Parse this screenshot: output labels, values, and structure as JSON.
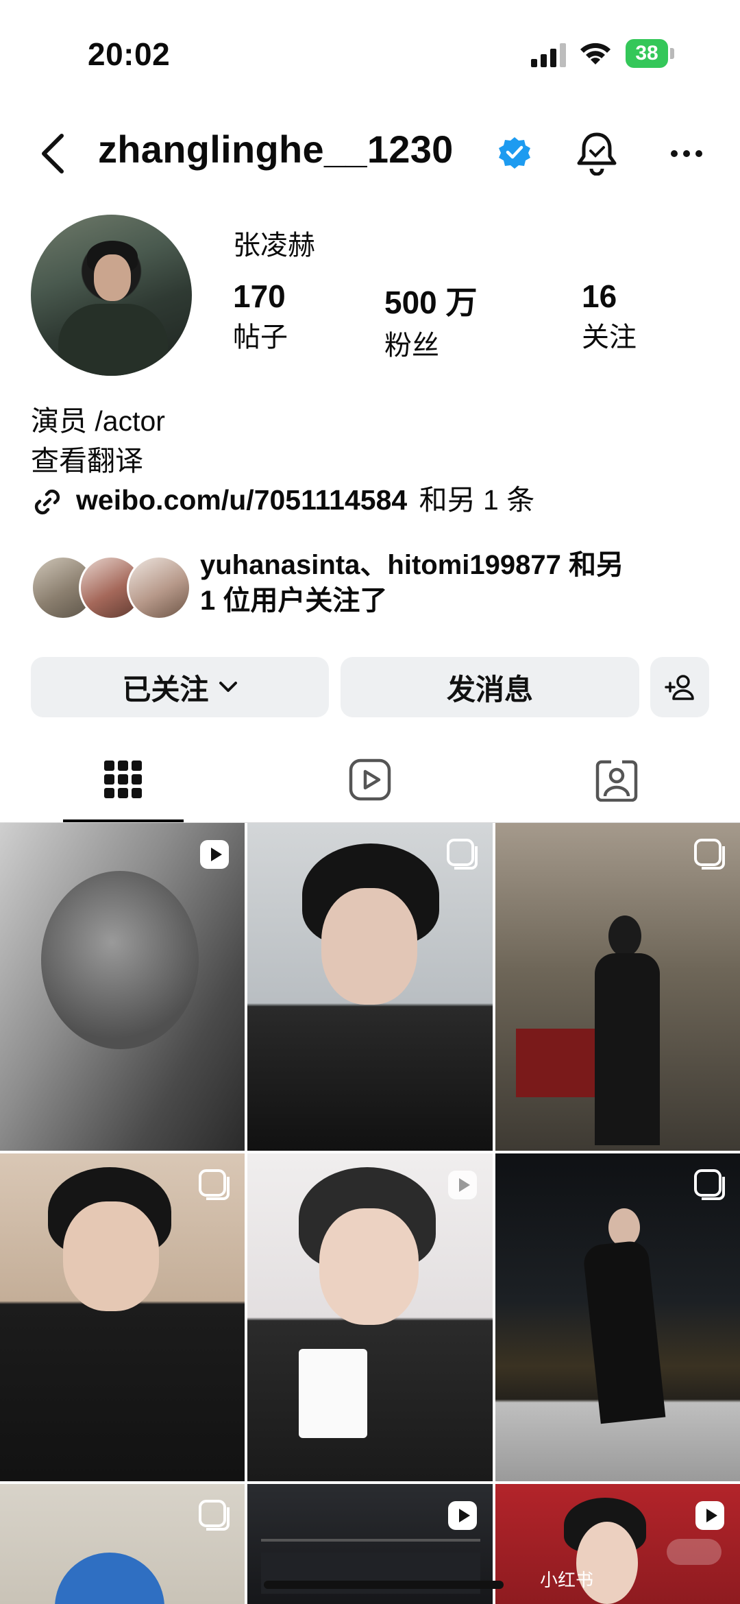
{
  "status_bar": {
    "time": "20:02",
    "battery": "38"
  },
  "header": {
    "username": "zhanglinghe__1230"
  },
  "profile": {
    "display_name": "张凌赫",
    "stats": [
      {
        "value": "170",
        "label": "帖子"
      },
      {
        "value": "500 万",
        "label": "粉丝"
      },
      {
        "value": "16",
        "label": "关注"
      }
    ],
    "bio": "演员 /actor",
    "translate": "查看翻译",
    "link": "weibo.com/u/7051114584",
    "link_suffix": "和另 1 条",
    "mutual_line1": "yuhanasinta、hitomi199877 和另",
    "mutual_line2": "1 位用户关注了"
  },
  "buttons": {
    "following": "已关注",
    "message": "发消息"
  },
  "grid": {
    "tiles": [
      {
        "type": "reel"
      },
      {
        "type": "carousel"
      },
      {
        "type": "carousel"
      },
      {
        "type": "carousel"
      },
      {
        "type": "reel"
      },
      {
        "type": "carousel"
      },
      {
        "type": "carousel"
      },
      {
        "type": "reel"
      },
      {
        "type": "reel"
      }
    ],
    "watermark": "小红书"
  },
  "colors": {
    "verified": "#1d9bf0",
    "battery": "#34c759",
    "button_bg": "#eef0f2"
  },
  "icons": [
    "back-arrow-icon",
    "verified-icon",
    "bell-icon",
    "more-icon",
    "link-icon",
    "chevron-down-icon",
    "add-person-icon",
    "grid-icon",
    "reels-icon",
    "tagged-icon"
  ]
}
